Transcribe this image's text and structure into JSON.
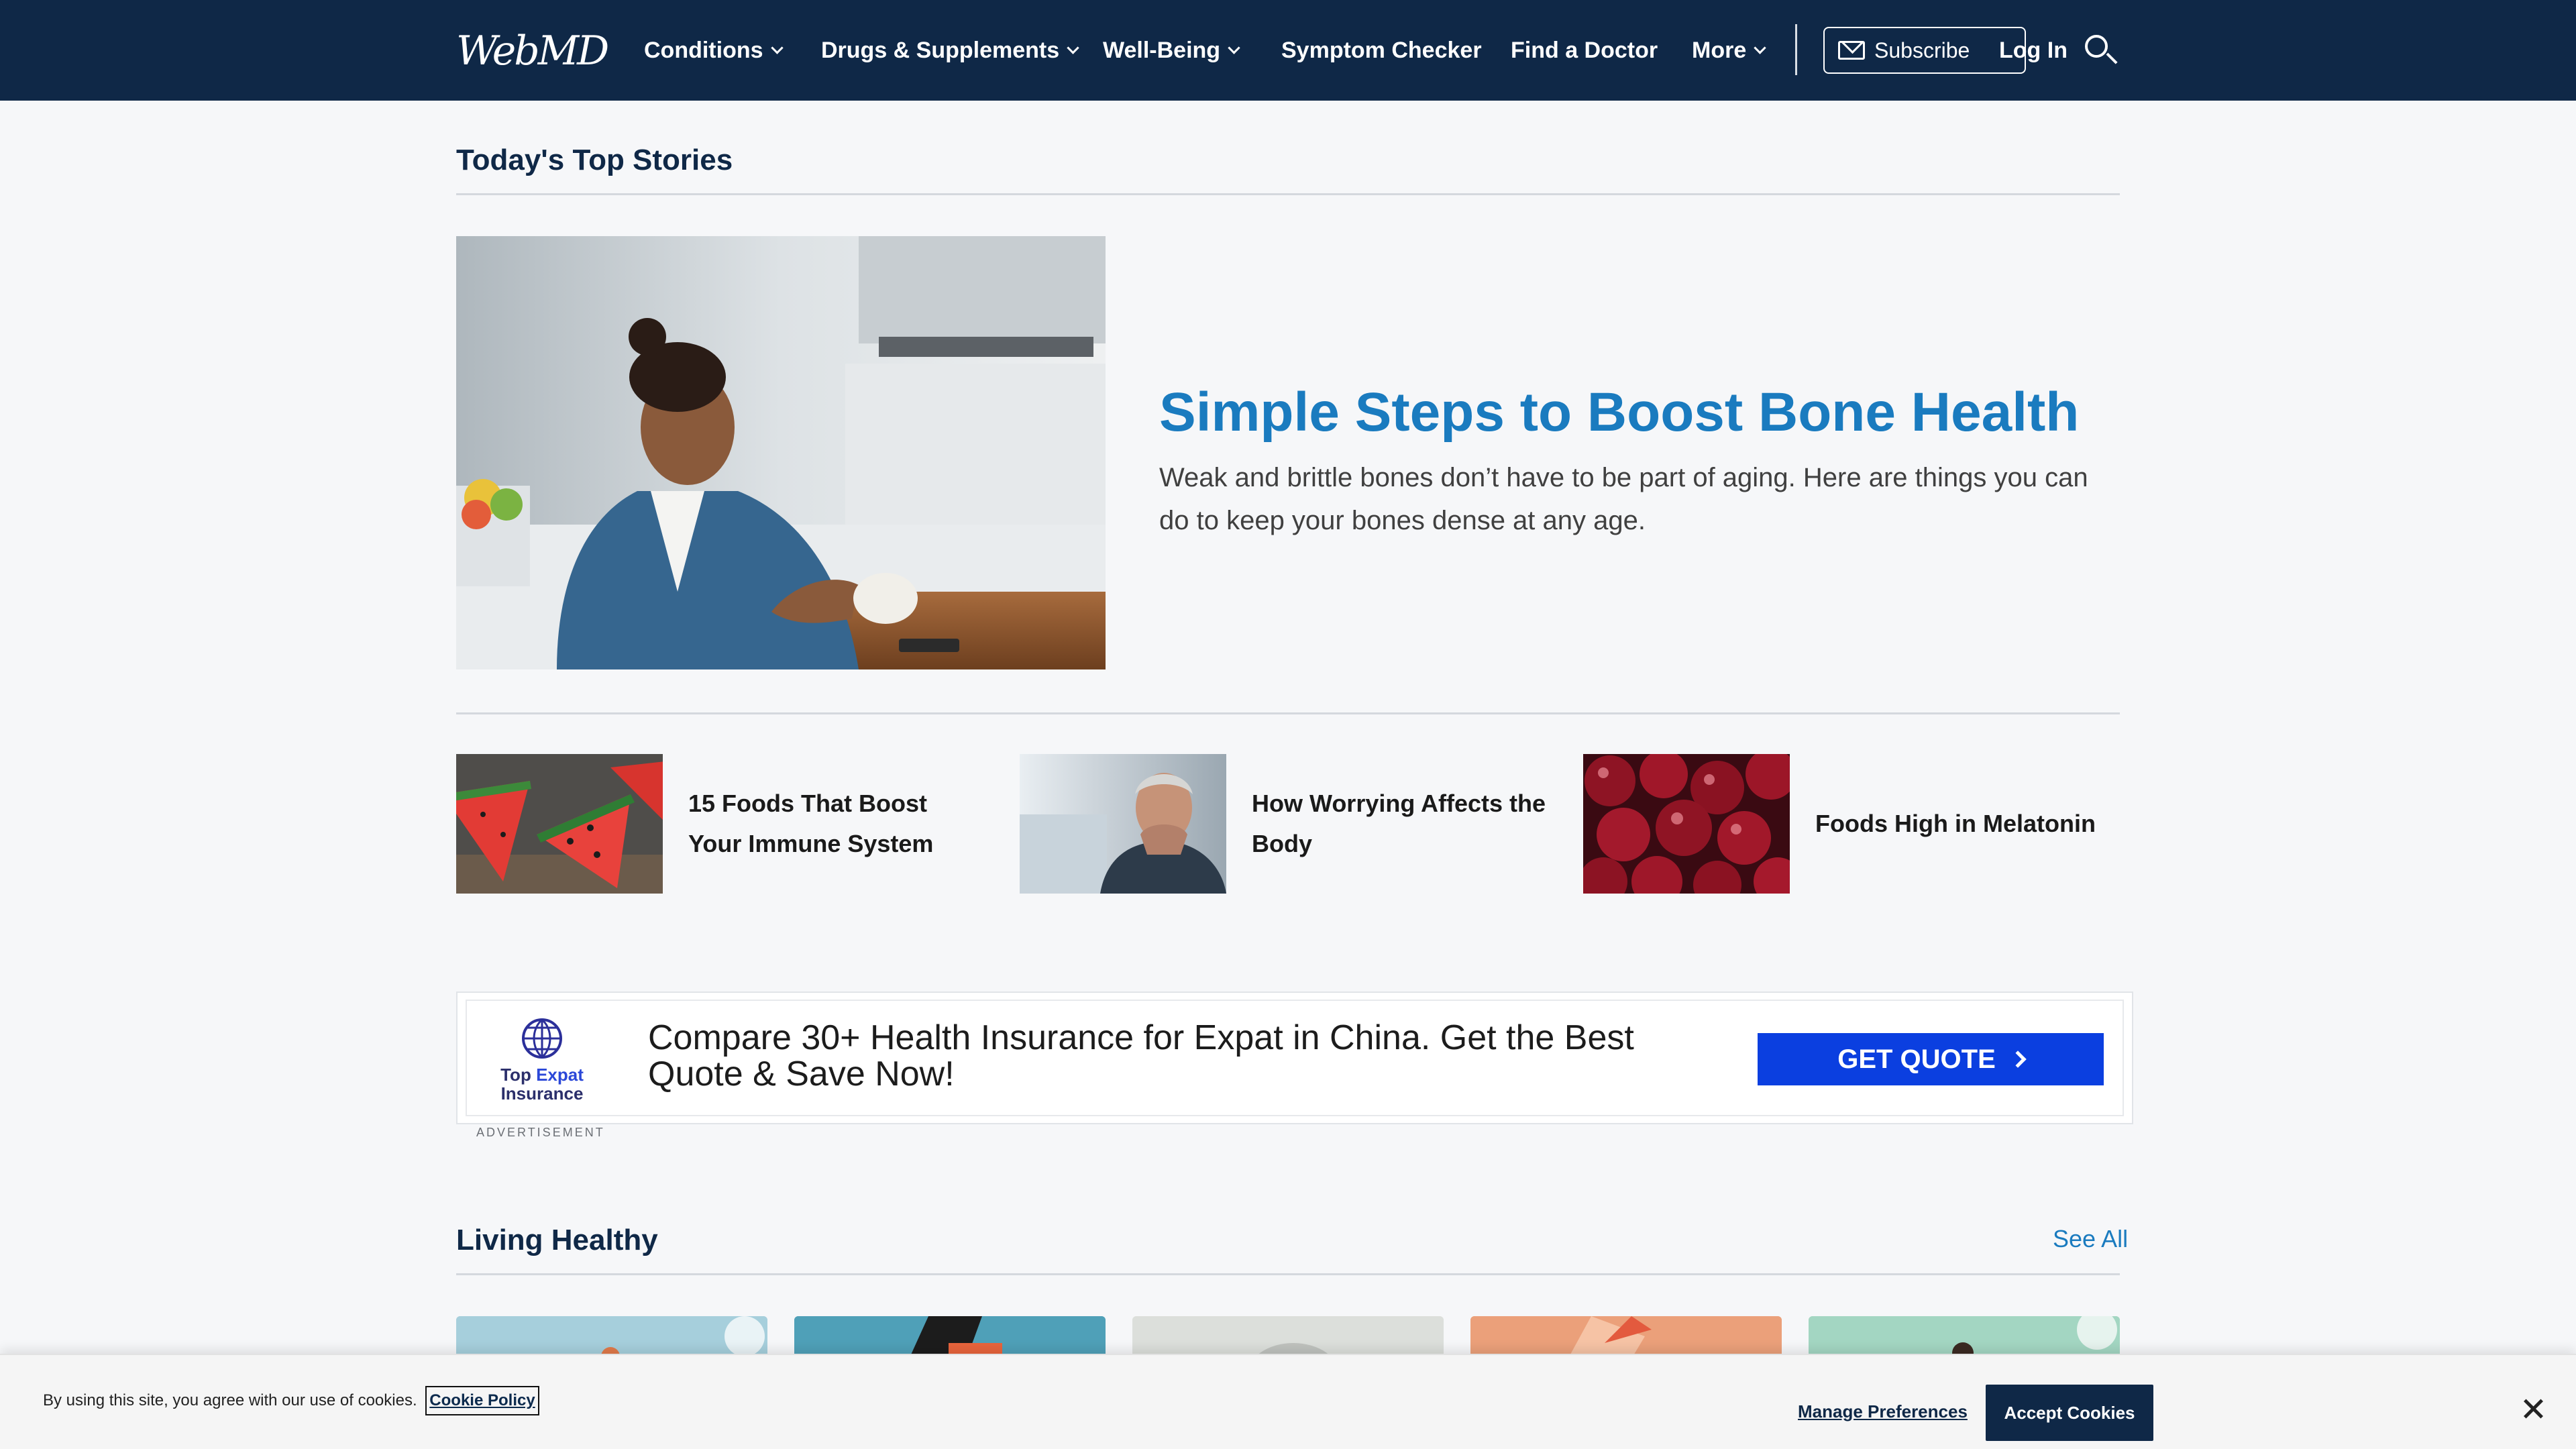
{
  "header": {
    "logo": "WebMD",
    "nav": [
      {
        "label": "Conditions",
        "has_dropdown": true
      },
      {
        "label": "Drugs & Supplements",
        "has_dropdown": true
      },
      {
        "label": "Well-Being",
        "has_dropdown": true
      },
      {
        "label": "Symptom Checker",
        "has_dropdown": false
      },
      {
        "label": "Find a Doctor",
        "has_dropdown": false
      },
      {
        "label": "More",
        "has_dropdown": true
      }
    ],
    "subscribe_label": "Subscribe",
    "login_label": "Log In",
    "search_icon": "search-icon",
    "bg_color": "#0f2847"
  },
  "top_stories": {
    "section_title": "Today's Top Stories",
    "hero": {
      "title": "Simple Steps to Boost Bone Health",
      "description": "Weak and brittle bones don’t have to be part of aging. Here are things you can do to keep your bones dense at any age."
    },
    "stories": [
      {
        "title": "15 Foods That Boost Your Immune System",
        "image": "watermelon slices"
      },
      {
        "title": "How Worrying Affects the Body",
        "image": "worried older man"
      },
      {
        "title": "Foods High in Melatonin",
        "image": "cherries"
      }
    ]
  },
  "ad": {
    "brand": "Top Expat Insurance",
    "brand_line1_a": "Top",
    "brand_line1_b": "Expat",
    "brand_line2": "Insurance",
    "text": "Compare 30+ Health Insurance for Expat in China. Get the Best Quote & Save Now!",
    "cta": "GET QUOTE",
    "label": "ADVERTISEMENT",
    "cta_color": "#0b3fe0"
  },
  "living_healthy": {
    "section_title": "Living Healthy",
    "see_all": "See All",
    "cards": 5
  },
  "cookie_banner": {
    "text": "By using this site, you agree with our use of cookies.",
    "policy_link": "Cookie Policy",
    "manage": "Manage Preferences",
    "accept": "Accept Cookies"
  },
  "accent_color": "#1a7bbf"
}
